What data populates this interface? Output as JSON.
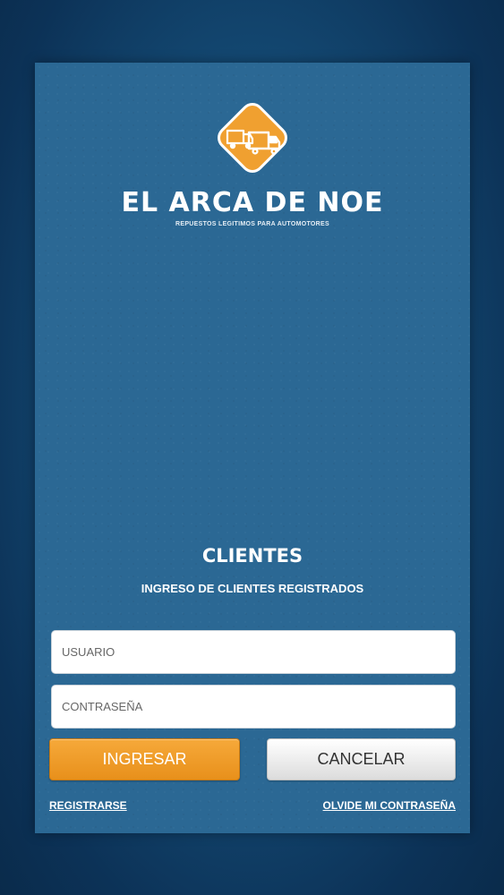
{
  "brand": {
    "name": "EL ARCA DE NOE",
    "tagline": "REPUESTOS LEGITIMOS PARA AUTOMOTORES",
    "logo_icon": "trucks-diamond-logo",
    "accent_color": "#f0a030"
  },
  "login": {
    "title": "CLIENTES",
    "subtitle": "INGRESO DE CLIENTES REGISTRADOS",
    "username": {
      "placeholder": "USUARIO",
      "value": ""
    },
    "password": {
      "placeholder": "CONTRASEÑA",
      "value": ""
    },
    "submit_label": "INGRESAR",
    "cancel_label": "CANCELAR",
    "register_link": "REGISTRARSE",
    "forgot_link": "OLVIDE MI CONTRASEÑA"
  }
}
